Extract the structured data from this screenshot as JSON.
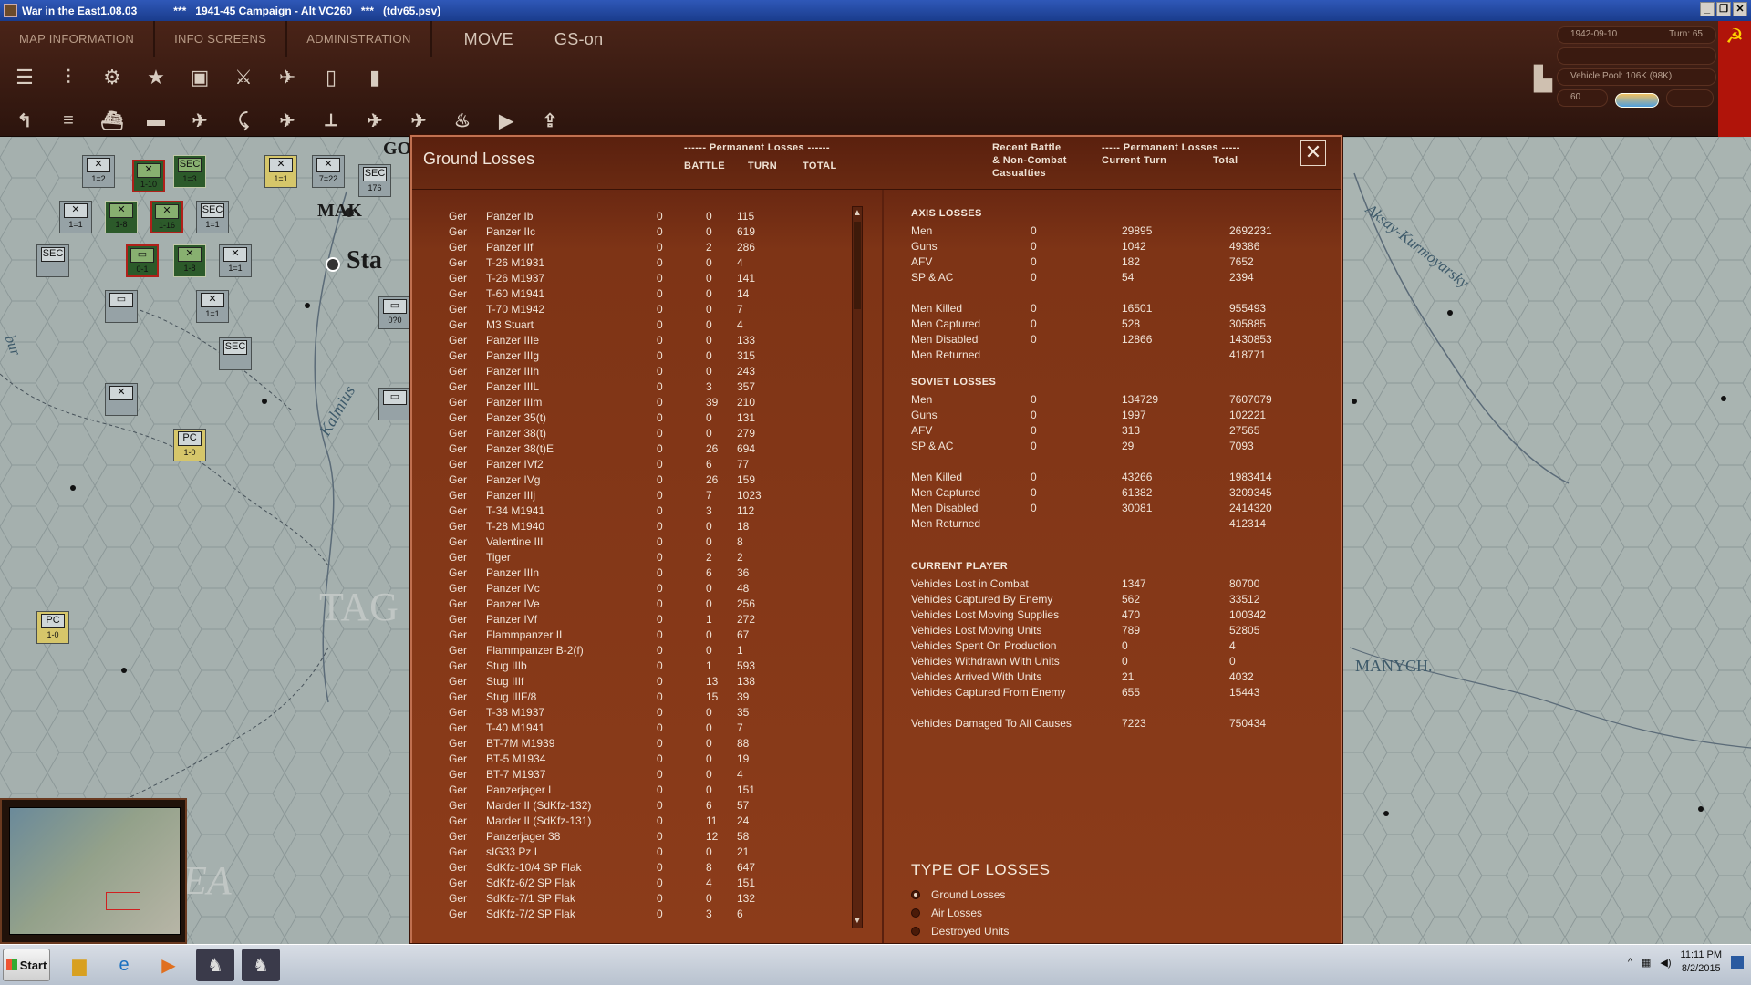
{
  "window": {
    "app_title": "War in the East1.08.03",
    "stars_left": "***",
    "scenario": "1941-45 Campaign - Alt VC260",
    "stars_right": "***",
    "file": "(tdv65.psv)"
  },
  "menu": {
    "map_information": "MAP INFORMATION",
    "info_screens": "INFO SCREENS",
    "administration": "ADMINISTRATION",
    "move": "MOVE",
    "gs_on": "GS-on"
  },
  "status": {
    "date": "1942-09-10",
    "turn": "Turn: 65",
    "vehicle_pool": "Vehicle Pool: 106K (98K)",
    "value_60": "60"
  },
  "map": {
    "city_partial": "MAK",
    "city_sta": "Sta",
    "city_go": "GO",
    "river_kalmius": "Kalmius",
    "region_tag": "TAG",
    "region_ea": "EA",
    "river_aksay": "Aksay-Kurmoyarsky",
    "river_manych": "MANYCH.",
    "river_bur": "bur",
    "units": [
      "1=2",
      "1-10",
      "1=3",
      "1=1",
      "7=22",
      "176",
      "1=1",
      "1-8",
      "1-16",
      "1=1",
      "0-1",
      "1-8",
      "1=1",
      "1=1",
      "1-0",
      "1-0",
      "0?0"
    ]
  },
  "dialog": {
    "title": "Ground Losses",
    "perm_header": "------ Permanent Losses ------",
    "col_battle": "BATTLE",
    "col_turn": "TURN",
    "col_total": "TOTAL",
    "recent_header_1": "Recent Battle",
    "recent_header_2": "& Non-Combat",
    "recent_header_3": "Casualties",
    "perm_header_right": "----- Permanent Losses -----",
    "col_current_turn": "Current Turn",
    "col_total_right": "Total",
    "close": "✕"
  },
  "equipment": [
    {
      "nat": "Ger",
      "name": "Panzer Ib",
      "battle": "0",
      "turn": "0",
      "total": "115"
    },
    {
      "nat": "Ger",
      "name": "Panzer IIc",
      "battle": "0",
      "turn": "0",
      "total": "619"
    },
    {
      "nat": "Ger",
      "name": "Panzer IIf",
      "battle": "0",
      "turn": "2",
      "total": "286"
    },
    {
      "nat": "Ger",
      "name": "T-26 M1931",
      "battle": "0",
      "turn": "0",
      "total": "4"
    },
    {
      "nat": "Ger",
      "name": "T-26 M1937",
      "battle": "0",
      "turn": "0",
      "total": "141"
    },
    {
      "nat": "Ger",
      "name": "T-60 M1941",
      "battle": "0",
      "turn": "0",
      "total": "14"
    },
    {
      "nat": "Ger",
      "name": "T-70 M1942",
      "battle": "0",
      "turn": "0",
      "total": "7"
    },
    {
      "nat": "Ger",
      "name": "M3 Stuart",
      "battle": "0",
      "turn": "0",
      "total": "4"
    },
    {
      "nat": "Ger",
      "name": "Panzer IIIe",
      "battle": "0",
      "turn": "0",
      "total": "133"
    },
    {
      "nat": "Ger",
      "name": "Panzer IIIg",
      "battle": "0",
      "turn": "0",
      "total": "315"
    },
    {
      "nat": "Ger",
      "name": "Panzer IIIh",
      "battle": "0",
      "turn": "0",
      "total": "243"
    },
    {
      "nat": "Ger",
      "name": "Panzer IIIL",
      "battle": "0",
      "turn": "3",
      "total": "357"
    },
    {
      "nat": "Ger",
      "name": "Panzer IIIm",
      "battle": "0",
      "turn": "39",
      "total": "210"
    },
    {
      "nat": "Ger",
      "name": "Panzer 35(t)",
      "battle": "0",
      "turn": "0",
      "total": "131"
    },
    {
      "nat": "Ger",
      "name": "Panzer 38(t)",
      "battle": "0",
      "turn": "0",
      "total": "279"
    },
    {
      "nat": "Ger",
      "name": "Panzer 38(t)E",
      "battle": "0",
      "turn": "26",
      "total": "694"
    },
    {
      "nat": "Ger",
      "name": "Panzer IVf2",
      "battle": "0",
      "turn": "6",
      "total": "77"
    },
    {
      "nat": "Ger",
      "name": "Panzer IVg",
      "battle": "0",
      "turn": "26",
      "total": "159"
    },
    {
      "nat": "Ger",
      "name": "Panzer IIIj",
      "battle": "0",
      "turn": "7",
      "total": "1023"
    },
    {
      "nat": "Ger",
      "name": "T-34 M1941",
      "battle": "0",
      "turn": "3",
      "total": "112"
    },
    {
      "nat": "Ger",
      "name": "T-28 M1940",
      "battle": "0",
      "turn": "0",
      "total": "18"
    },
    {
      "nat": "Ger",
      "name": "Valentine III",
      "battle": "0",
      "turn": "0",
      "total": "8"
    },
    {
      "nat": "Ger",
      "name": "Tiger",
      "battle": "0",
      "turn": "2",
      "total": "2"
    },
    {
      "nat": "Ger",
      "name": "Panzer IIIn",
      "battle": "0",
      "turn": "6",
      "total": "36"
    },
    {
      "nat": "Ger",
      "name": "Panzer IVc",
      "battle": "0",
      "turn": "0",
      "total": "48"
    },
    {
      "nat": "Ger",
      "name": "Panzer IVe",
      "battle": "0",
      "turn": "0",
      "total": "256"
    },
    {
      "nat": "Ger",
      "name": "Panzer IVf",
      "battle": "0",
      "turn": "1",
      "total": "272"
    },
    {
      "nat": "Ger",
      "name": "Flammpanzer II",
      "battle": "0",
      "turn": "0",
      "total": "67"
    },
    {
      "nat": "Ger",
      "name": "Flammpanzer B-2(f)",
      "battle": "0",
      "turn": "0",
      "total": "1"
    },
    {
      "nat": "Ger",
      "name": "Stug IIIb",
      "battle": "0",
      "turn": "1",
      "total": "593"
    },
    {
      "nat": "Ger",
      "name": "Stug IIIf",
      "battle": "0",
      "turn": "13",
      "total": "138"
    },
    {
      "nat": "Ger",
      "name": "Stug IIIF/8",
      "battle": "0",
      "turn": "15",
      "total": "39"
    },
    {
      "nat": "Ger",
      "name": "T-38 M1937",
      "battle": "0",
      "turn": "0",
      "total": "35"
    },
    {
      "nat": "Ger",
      "name": "T-40 M1941",
      "battle": "0",
      "turn": "0",
      "total": "7"
    },
    {
      "nat": "Ger",
      "name": "BT-7M M1939",
      "battle": "0",
      "turn": "0",
      "total": "88"
    },
    {
      "nat": "Ger",
      "name": "BT-5 M1934",
      "battle": "0",
      "turn": "0",
      "total": "19"
    },
    {
      "nat": "Ger",
      "name": "BT-7 M1937",
      "battle": "0",
      "turn": "0",
      "total": "4"
    },
    {
      "nat": "Ger",
      "name": "Panzerjager I",
      "battle": "0",
      "turn": "0",
      "total": "151"
    },
    {
      "nat": "Ger",
      "name": "Marder II (SdKfz-132)",
      "battle": "0",
      "turn": "6",
      "total": "57"
    },
    {
      "nat": "Ger",
      "name": "Marder II (SdKfz-131)",
      "battle": "0",
      "turn": "11",
      "total": "24"
    },
    {
      "nat": "Ger",
      "name": "Panzerjager 38",
      "battle": "0",
      "turn": "12",
      "total": "58"
    },
    {
      "nat": "Ger",
      "name": "sIG33 Pz I",
      "battle": "0",
      "turn": "0",
      "total": "21"
    },
    {
      "nat": "Ger",
      "name": "SdKfz-10/4 SP Flak",
      "battle": "0",
      "turn": "8",
      "total": "647"
    },
    {
      "nat": "Ger",
      "name": "SdKfz-6/2 SP Flak",
      "battle": "0",
      "turn": "4",
      "total": "151"
    },
    {
      "nat": "Ger",
      "name": "SdKfz-7/1 SP Flak",
      "battle": "0",
      "turn": "0",
      "total": "132"
    },
    {
      "nat": "Ger",
      "name": "SdKfz-7/2 SP Flak",
      "battle": "0",
      "turn": "3",
      "total": "6"
    }
  ],
  "axis": {
    "heading": "AXIS LOSSES",
    "rows": [
      {
        "label": "Men",
        "recent": "0",
        "current": "29895",
        "total": "2692231"
      },
      {
        "label": "Guns",
        "recent": "0",
        "current": "1042",
        "total": "49386"
      },
      {
        "label": "AFV",
        "recent": "0",
        "current": "182",
        "total": "7652"
      },
      {
        "label": "SP & AC",
        "recent": "0",
        "current": "54",
        "total": "2394"
      },
      {
        "label": "Men Killed",
        "recent": "0",
        "current": "16501",
        "total": "955493"
      },
      {
        "label": "Men Captured",
        "recent": "0",
        "current": "528",
        "total": "305885"
      },
      {
        "label": "Men Disabled",
        "recent": "0",
        "current": "12866",
        "total": "1430853"
      },
      {
        "label": "Men Returned",
        "recent": "",
        "current": "",
        "total": "418771"
      }
    ]
  },
  "soviet": {
    "heading": "SOVIET LOSSES",
    "rows": [
      {
        "label": "Men",
        "recent": "0",
        "current": "134729",
        "total": "7607079"
      },
      {
        "label": "Guns",
        "recent": "0",
        "current": "1997",
        "total": "102221"
      },
      {
        "label": "AFV",
        "recent": "0",
        "current": "313",
        "total": "27565"
      },
      {
        "label": "SP & AC",
        "recent": "0",
        "current": "29",
        "total": "7093"
      },
      {
        "label": "Men Killed",
        "recent": "0",
        "current": "43266",
        "total": "1983414"
      },
      {
        "label": "Men Captured",
        "recent": "0",
        "current": "61382",
        "total": "3209345"
      },
      {
        "label": "Men Disabled",
        "recent": "0",
        "current": "30081",
        "total": "2414320"
      },
      {
        "label": "Men Returned",
        "recent": "",
        "current": "",
        "total": "412314"
      }
    ]
  },
  "current_player": {
    "heading": "CURRENT PLAYER",
    "rows": [
      {
        "label": "Vehicles Lost in Combat",
        "current": "1347",
        "total": "80700"
      },
      {
        "label": "Vehicles Captured By Enemy",
        "current": "562",
        "total": "33512"
      },
      {
        "label": "Vehicles Lost Moving Supplies",
        "current": "470",
        "total": "100342"
      },
      {
        "label": "Vehicles Lost Moving Units",
        "current": "789",
        "total": "52805"
      },
      {
        "label": "Vehicles Spent On Production",
        "current": "0",
        "total": "4"
      },
      {
        "label": "Vehicles Withdrawn With Units",
        "current": "0",
        "total": "0"
      },
      {
        "label": "Vehicles Arrived With Units",
        "current": "21",
        "total": "4032"
      },
      {
        "label": "Vehicles Captured From Enemy",
        "current": "655",
        "total": "15443"
      }
    ],
    "damaged": {
      "label": "Vehicles Damaged To All Causes",
      "current": "7223",
      "total": "750434"
    }
  },
  "type_of_losses": {
    "heading": "TYPE OF LOSSES",
    "options": [
      "Ground Losses",
      "Air Losses",
      "Destroyed Units"
    ],
    "selected": "Ground Losses"
  },
  "taskbar": {
    "start": "Start",
    "time": "11:11 PM",
    "date": "8/2/2015"
  }
}
